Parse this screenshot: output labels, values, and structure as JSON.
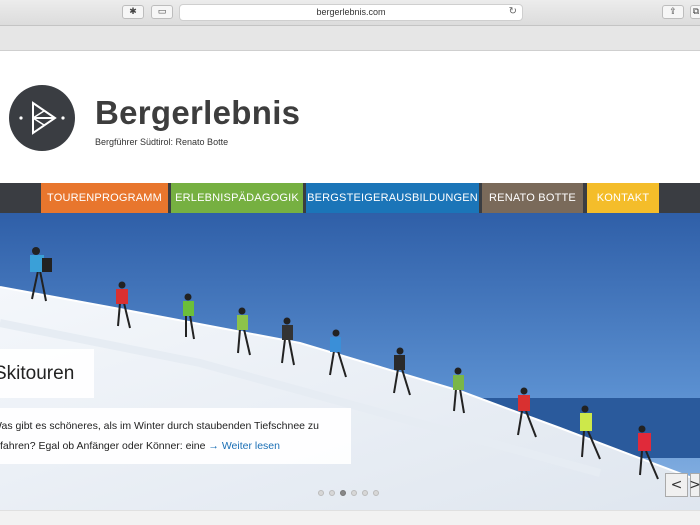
{
  "browser": {
    "url": "bergerlebnis.com",
    "reload_icon": "↻",
    "share_icon": "⇪",
    "sidebar_icon": "▭",
    "extension_icon": "✱",
    "tabs_icon": "⧉"
  },
  "header": {
    "title": "Bergerlebnis",
    "subtitle": "Bergführer Südtirol: Renato Botte"
  },
  "nav": {
    "items": [
      {
        "label": "TOURENPROGRAMM",
        "color": "#e8762d"
      },
      {
        "label": "ERLEBNISPÄDAGOGIK",
        "color": "#76b041"
      },
      {
        "label": "BERGSTEIGERAUSBILDUNGEN",
        "color": "#1b75b8"
      },
      {
        "label": "RENATO BOTTE",
        "color": "#7a6a5a"
      },
      {
        "label": "KONTAKT",
        "color": "#f4bd2a"
      }
    ]
  },
  "slider": {
    "caption_title": "Skitouren",
    "caption_line1": "Was gibt es schöneres, als im Winter durch staubenden Tiefschnee zu",
    "caption_line2": "fahren? Egal ob Anfänger oder Könner: eine ",
    "read_more": "→ Weiter lesen",
    "prev_label": "<",
    "next_label": ">",
    "slide_count": 6,
    "active_slide": 3
  }
}
